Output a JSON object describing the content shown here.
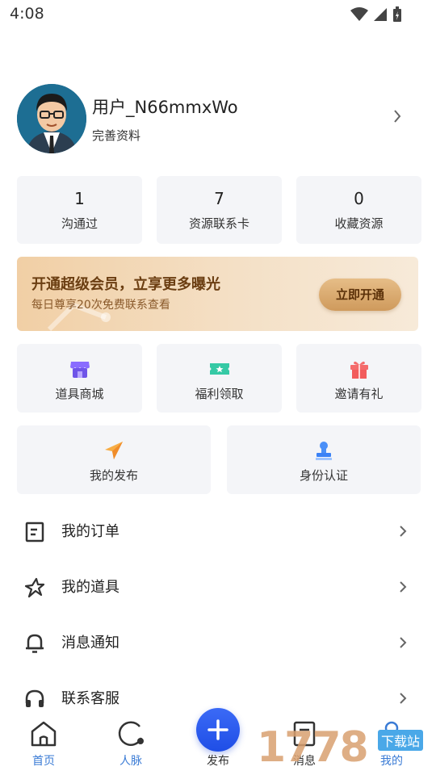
{
  "status_bar": {
    "time": "4:08"
  },
  "profile": {
    "username": "用户_N66mmxWo",
    "subtitle": "完善资料"
  },
  "stats": [
    {
      "value": "1",
      "label": "沟通过"
    },
    {
      "value": "7",
      "label": "资源联系卡"
    },
    {
      "value": "0",
      "label": "收藏资源"
    }
  ],
  "banner": {
    "title": "开通超级会员，立享更多曝光",
    "subtitle": "每日尊享20次免费联系查看",
    "button": "立即开通"
  },
  "tools_row1": [
    {
      "label": "道具商城",
      "icon": "shop-icon",
      "color": "#7b61ff"
    },
    {
      "label": "福利领取",
      "icon": "ticket-icon",
      "color": "#2ec4a0"
    },
    {
      "label": "邀请有礼",
      "icon": "gift-icon",
      "color": "#f25c5c"
    }
  ],
  "tools_row2": [
    {
      "label": "我的发布",
      "icon": "paper-plane-icon",
      "color": "#f5a63b"
    },
    {
      "label": "身份认证",
      "icon": "id-stamp-icon",
      "color": "#3b82f6"
    }
  ],
  "menu": [
    {
      "label": "我的订单",
      "icon": "order-icon"
    },
    {
      "label": "我的道具",
      "icon": "props-icon"
    },
    {
      "label": "消息通知",
      "icon": "bell-icon"
    },
    {
      "label": "联系客服",
      "icon": "headset-icon"
    }
  ],
  "bottom_nav": [
    {
      "label": "首页",
      "icon": "home-icon"
    },
    {
      "label": "人脉",
      "icon": "contacts-icon"
    },
    {
      "label": "发布",
      "icon": "plus-icon"
    },
    {
      "label": "消息",
      "icon": "message-icon"
    },
    {
      "label": "我的",
      "icon": "user-icon"
    }
  ],
  "watermark": {
    "text": "1778",
    "badge": "下载站"
  }
}
